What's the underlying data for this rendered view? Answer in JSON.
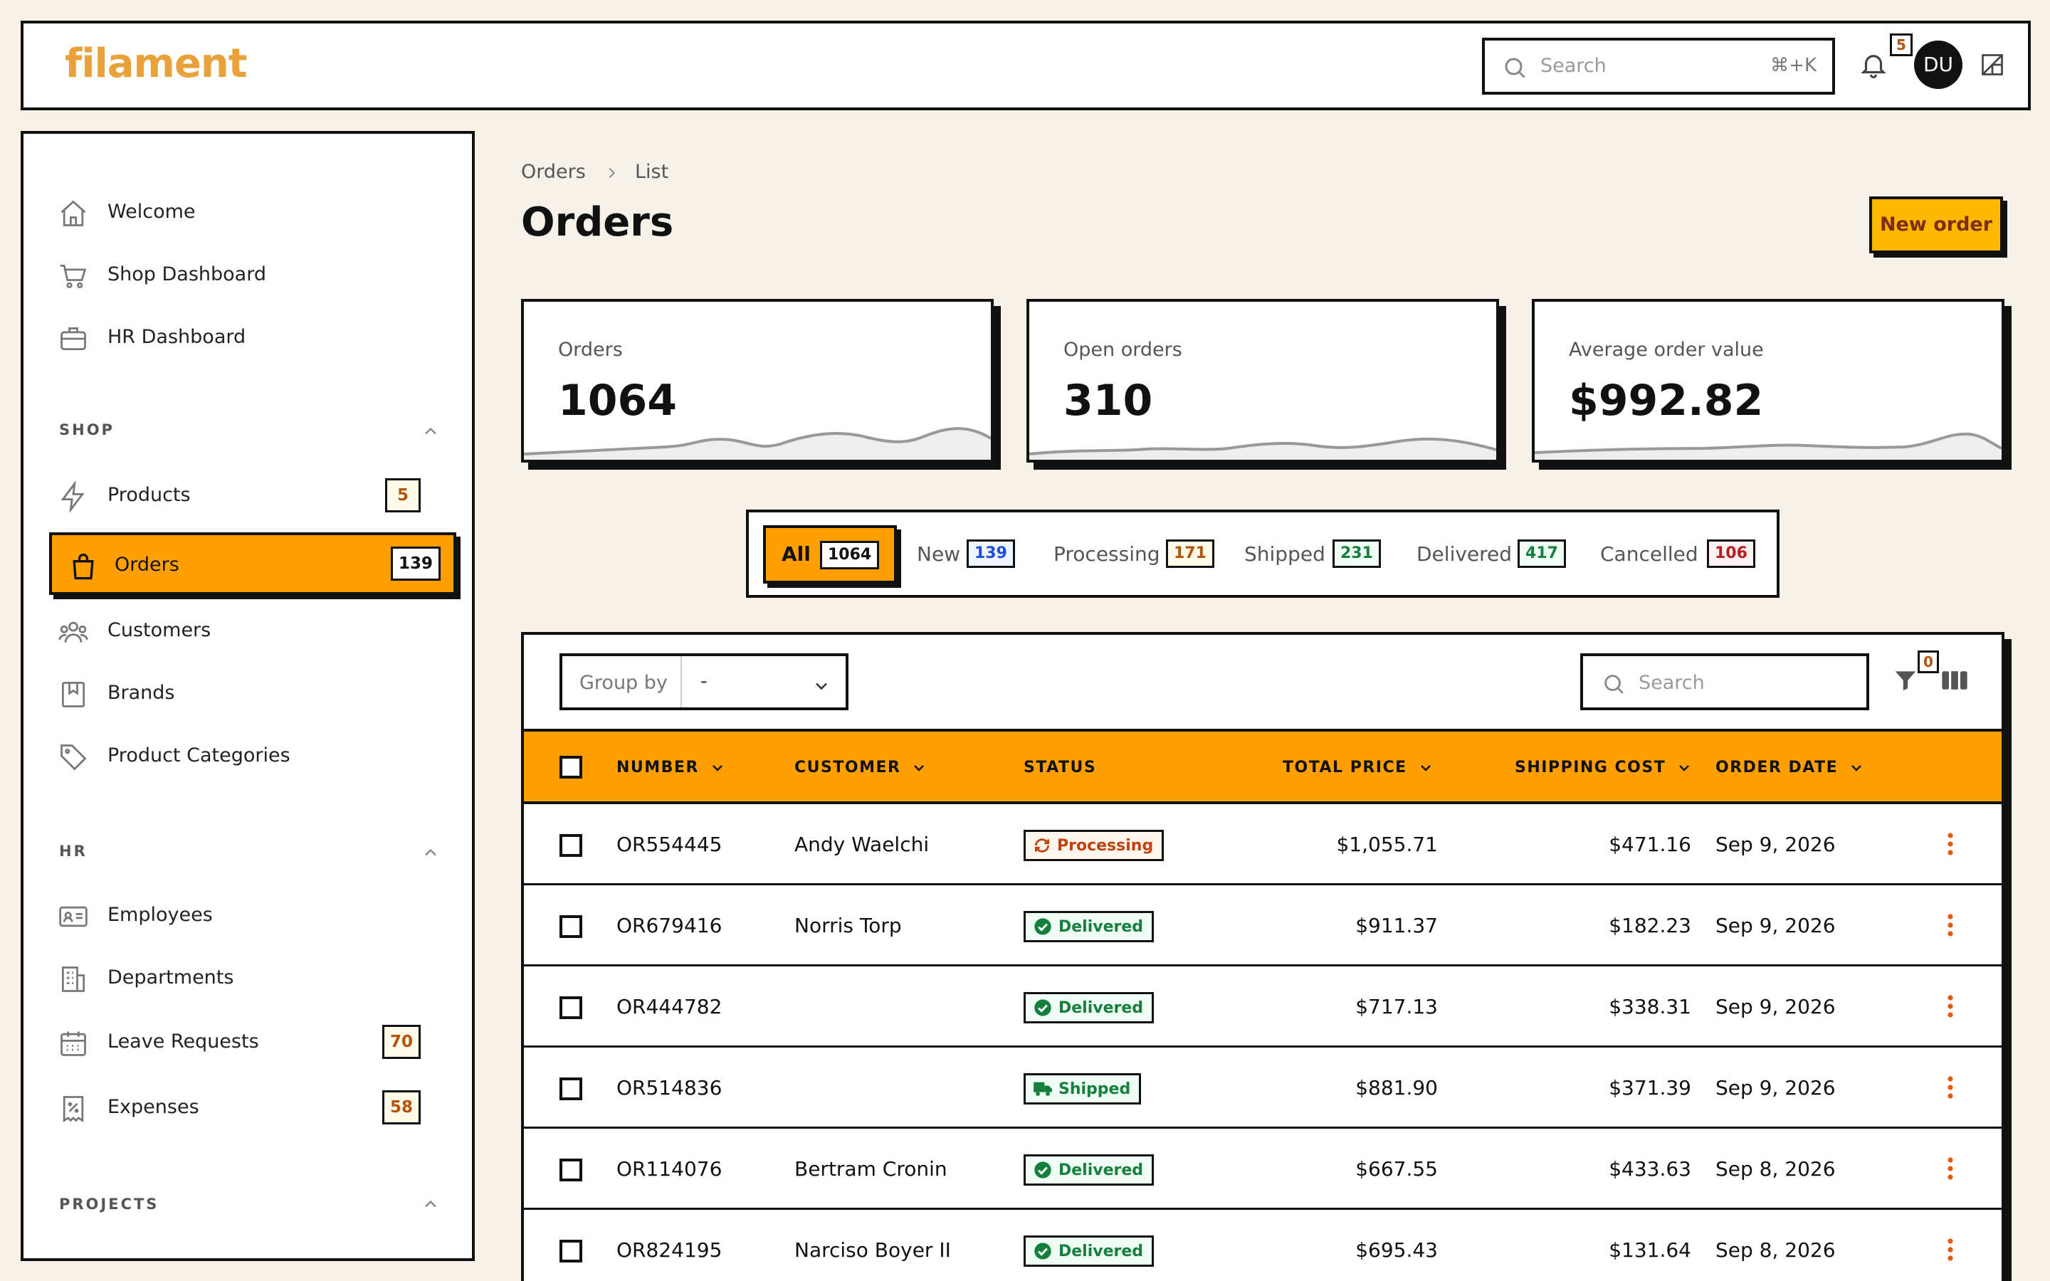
{
  "app": {
    "logo": "filament"
  },
  "topbar": {
    "search_placeholder": "Search",
    "search_shortcut": "⌘+K",
    "notifications_count": "5",
    "avatar_initials": "DU"
  },
  "sidebar": {
    "top_items": [
      {
        "label": "Welcome",
        "icon": "home-icon"
      },
      {
        "label": "Shop Dashboard",
        "icon": "cart-icon"
      },
      {
        "label": "HR Dashboard",
        "icon": "briefcase-icon"
      }
    ],
    "groups": {
      "shop": {
        "label": "SHOP",
        "items": [
          {
            "label": "Products",
            "icon": "bolt-icon",
            "count": "5"
          },
          {
            "label": "Orders",
            "icon": "shopping-bag-icon",
            "count": "139",
            "active": true
          },
          {
            "label": "Customers",
            "icon": "users-icon"
          },
          {
            "label": "Brands",
            "icon": "bookmark-icon"
          },
          {
            "label": "Product Categories",
            "icon": "tag-icon"
          }
        ]
      },
      "hr": {
        "label": "HR",
        "items": [
          {
            "label": "Employees",
            "icon": "id-card-icon"
          },
          {
            "label": "Departments",
            "icon": "building-icon"
          },
          {
            "label": "Leave Requests",
            "icon": "calendar-icon",
            "count": "70"
          },
          {
            "label": "Expenses",
            "icon": "receipt-icon",
            "count": "58"
          }
        ]
      },
      "projects": {
        "label": "PROJECTS"
      }
    }
  },
  "breadcrumb": [
    "Orders",
    "List"
  ],
  "page": {
    "title": "Orders",
    "new_button": "New order"
  },
  "stats": [
    {
      "label": "Orders",
      "value": "1064"
    },
    {
      "label": "Open orders",
      "value": "310"
    },
    {
      "label": "Average order value",
      "value": "$992.82"
    }
  ],
  "tabs": [
    {
      "label": "All",
      "count": "1064",
      "active": true,
      "color": "#111111"
    },
    {
      "label": "New",
      "count": "139",
      "color": "#1d4ed8"
    },
    {
      "label": "Processing",
      "count": "171",
      "color": "#b45309"
    },
    {
      "label": "Shipped",
      "count": "231",
      "color": "#15803d"
    },
    {
      "label": "Delivered",
      "count": "417",
      "color": "#15803d"
    },
    {
      "label": "Cancelled",
      "count": "106",
      "color": "#b91c1c"
    }
  ],
  "table": {
    "group_by_label": "Group by",
    "group_by_value": "-",
    "search_placeholder": "Search",
    "filter_count": "0",
    "columns": [
      "NUMBER",
      "CUSTOMER",
      "STATUS",
      "TOTAL PRICE",
      "SHIPPING COST",
      "ORDER DATE"
    ],
    "rows": [
      {
        "number": "OR554445",
        "customer": "Andy Waelchi",
        "status": "Processing",
        "total": "$1,055.71",
        "shipping": "$471.16",
        "date": "Sep 9, 2026"
      },
      {
        "number": "OR679416",
        "customer": "Norris Torp",
        "status": "Delivered",
        "total": "$911.37",
        "shipping": "$182.23",
        "date": "Sep 9, 2026"
      },
      {
        "number": "OR444782",
        "customer": "",
        "status": "Delivered",
        "total": "$717.13",
        "shipping": "$338.31",
        "date": "Sep 9, 2026"
      },
      {
        "number": "OR514836",
        "customer": "",
        "status": "Shipped",
        "total": "$881.90",
        "shipping": "$371.39",
        "date": "Sep 9, 2026"
      },
      {
        "number": "OR114076",
        "customer": "Bertram Cronin",
        "status": "Delivered",
        "total": "$667.55",
        "shipping": "$433.63",
        "date": "Sep 8, 2026"
      },
      {
        "number": "OR824195",
        "customer": "Narciso Boyer II",
        "status": "Delivered",
        "total": "$695.43",
        "shipping": "$131.64",
        "date": "Sep 8, 2026"
      }
    ]
  },
  "colors": {
    "accent": "#ff9f00",
    "button": "#ffb800",
    "logo": "#e9a23b",
    "background": "#f6f2ea"
  }
}
